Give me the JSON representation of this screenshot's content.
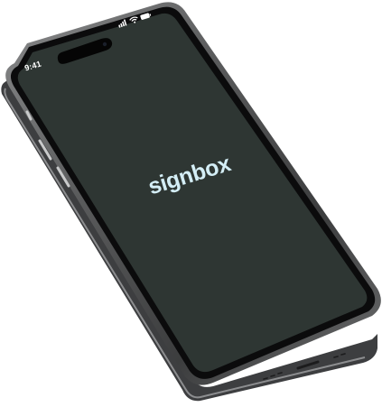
{
  "status_bar": {
    "time": "9:41",
    "icons": [
      "cellular-signal-icon",
      "wifi-icon",
      "battery-icon"
    ]
  },
  "screen": {
    "brand_name": "signbox",
    "background_color": "#2e3633",
    "brand_color": "#d4eef6"
  },
  "device": {
    "frame_color": "#4a4b4c"
  }
}
